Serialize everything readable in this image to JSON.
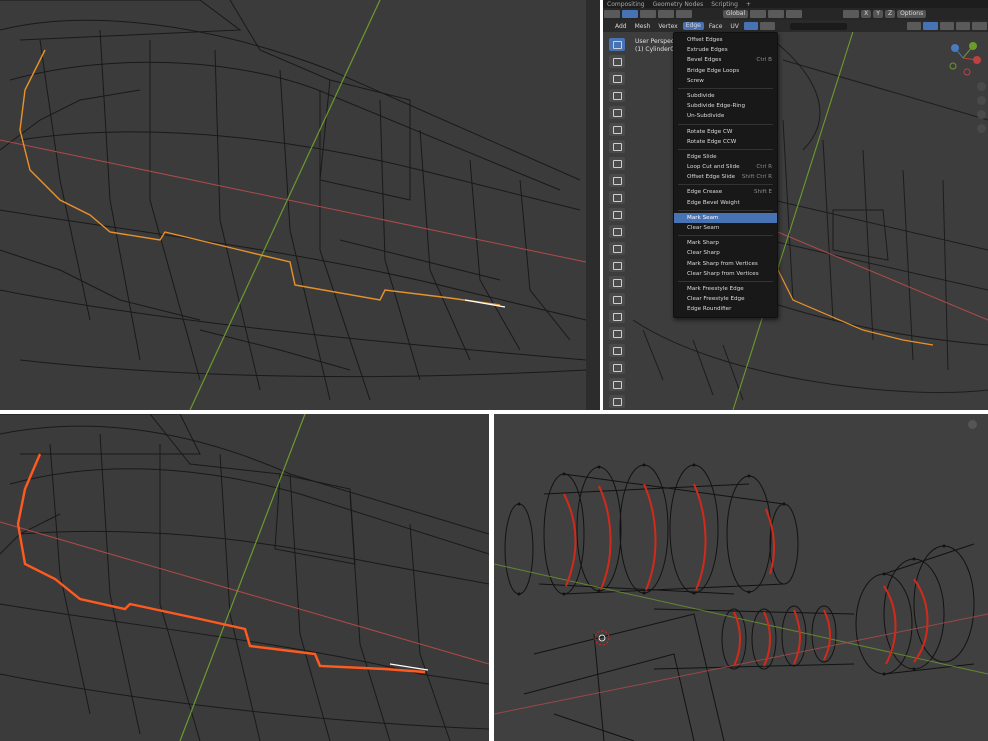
{
  "header": {
    "top_tabs": [
      "Compositing",
      "Geometry Nodes",
      "Scripting"
    ],
    "menus": [
      "Add",
      "Mesh",
      "Vertex",
      "Edge",
      "Face",
      "UV"
    ],
    "active_menu": "Edge",
    "orientation": "Global",
    "axes": [
      "X",
      "Y",
      "Z"
    ],
    "options": "Options"
  },
  "viewport": {
    "name": "User Perspective",
    "object": "(1) Cylinder00"
  },
  "edge_menu": {
    "items": [
      {
        "label": "Offset Edges",
        "shortcut": ""
      },
      {
        "label": "Extrude Edges",
        "shortcut": ""
      },
      {
        "label": "Bevel Edges",
        "shortcut": "Ctrl B"
      },
      {
        "label": "Bridge Edge Loops",
        "shortcut": ""
      },
      {
        "label": "Screw",
        "shortcut": ""
      },
      {
        "sep": true
      },
      {
        "label": "Subdivide",
        "shortcut": ""
      },
      {
        "label": "Subdivide Edge-Ring",
        "shortcut": ""
      },
      {
        "label": "Un-Subdivide",
        "shortcut": ""
      },
      {
        "sep": true
      },
      {
        "label": "Rotate Edge CW",
        "shortcut": ""
      },
      {
        "label": "Rotate Edge CCW",
        "shortcut": ""
      },
      {
        "sep": true
      },
      {
        "label": "Edge Slide",
        "shortcut": ""
      },
      {
        "label": "Loop Cut and Slide",
        "shortcut": "Ctrl R"
      },
      {
        "label": "Offset Edge Slide",
        "shortcut": "Shift Ctrl R"
      },
      {
        "sep": true
      },
      {
        "label": "Edge Crease",
        "shortcut": "Shift E"
      },
      {
        "label": "Edge Bevel Weight",
        "shortcut": ""
      },
      {
        "sep": true
      },
      {
        "label": "Mark Seam",
        "shortcut": "",
        "highlighted": true
      },
      {
        "label": "Clear Seam",
        "shortcut": ""
      },
      {
        "sep": true
      },
      {
        "label": "Mark Sharp",
        "shortcut": ""
      },
      {
        "label": "Clear Sharp",
        "shortcut": ""
      },
      {
        "label": "Mark Sharp from Vertices",
        "shortcut": ""
      },
      {
        "label": "Clear Sharp from Vertices",
        "shortcut": ""
      },
      {
        "sep": true
      },
      {
        "label": "Mark Freestyle Edge",
        "shortcut": ""
      },
      {
        "label": "Clear Freestyle Edge",
        "shortcut": ""
      },
      {
        "label": "Edge Roundifier",
        "shortcut": ""
      }
    ]
  },
  "colors": {
    "viewport_bg": "#3b3b3b",
    "wire": "#141414",
    "selected_edge": "#e8922a",
    "seam": "#ff5a1f",
    "seam_red": "#d12a1a",
    "x_axis": "#b04a4a",
    "y_axis": "#6c9a2c",
    "highlight": "#4772b3"
  },
  "tool_icons": [
    "select-box-icon",
    "cursor-icon",
    "move-icon",
    "rotate-icon",
    "scale-icon",
    "transform-icon",
    "annotate-icon",
    "measure-icon",
    "add-cube-icon",
    "extrude-icon",
    "inset-icon",
    "bevel-icon",
    "loop-cut-icon",
    "offset-edge-icon",
    "knife-icon",
    "poly-build-icon",
    "spin-icon",
    "smooth-icon",
    "edge-slide-icon",
    "shrink-icon",
    "shear-icon",
    "rip-icon"
  ]
}
